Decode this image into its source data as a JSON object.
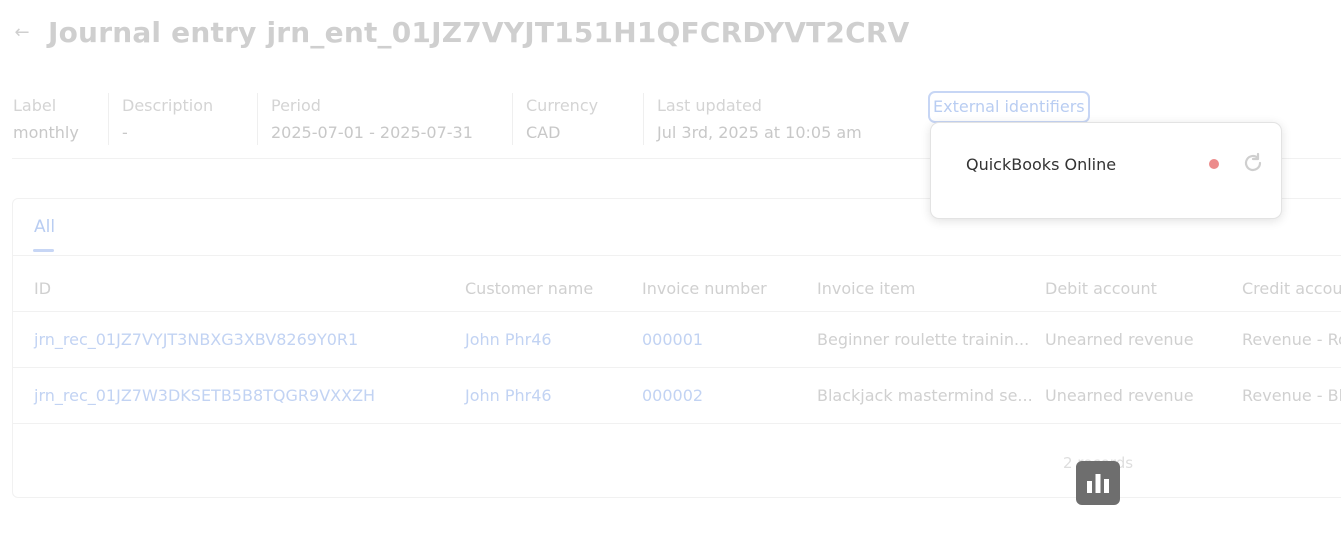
{
  "header": {
    "title": "Journal entry jrn_ent_01JZ7VYJT151H1QFCRDYVT2CRV"
  },
  "meta": {
    "label": {
      "label": "Label",
      "value": "monthly"
    },
    "description": {
      "label": "Description",
      "value": "-"
    },
    "period": {
      "label": "Period",
      "value": "2025-07-01 - 2025-07-31"
    },
    "currency": {
      "label": "Currency",
      "value": "CAD"
    },
    "last_updated": {
      "label": "Last updated",
      "value": "Jul 3rd, 2025 at 10:05 am"
    }
  },
  "external_identifiers": {
    "button_label": "External identifiers",
    "items": [
      {
        "name": "QuickBooks Online",
        "status_color": "#ec8b8b",
        "action_icon": "sync-icon"
      }
    ]
  },
  "tabs": [
    {
      "label": "All"
    }
  ],
  "table": {
    "columns": [
      "ID",
      "Customer name",
      "Invoice number",
      "Invoice item",
      "Debit account",
      "Credit accou"
    ],
    "rows": [
      {
        "id": "jrn_rec_01JZ7VYJT3NBXG3XBV8269Y0R1",
        "customer": "John Phr46",
        "invoice_number": "000001",
        "invoice_item": "Beginner roulette trainin...",
        "debit": "Unearned revenue",
        "credit": "Revenue - Ro"
      },
      {
        "id": "jrn_rec_01JZ7W3DKSETB5B8TQGR9VXXZH",
        "customer": "John Phr46",
        "invoice_number": "000002",
        "invoice_item": "Blackjack mastermind se...",
        "debit": "Unearned revenue",
        "credit": "Revenue - Bla"
      }
    ],
    "footer": "2 records"
  },
  "colors": {
    "accent": "#b9cdf2",
    "status_error": "#ec8b8b"
  }
}
